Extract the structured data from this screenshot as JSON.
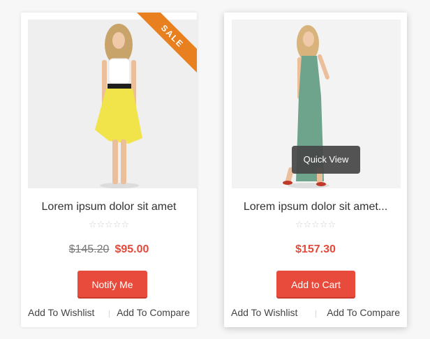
{
  "products": [
    {
      "title": "Lorem ipsum dolor sit amet",
      "rating": 0,
      "old_price": "$145.20",
      "price": "$95.00",
      "badge": "SALE",
      "button_label": "Notify Me",
      "wishlist_label": "Add To Wishlist",
      "compare_label": "Add To Compare"
    },
    {
      "title": "Lorem ipsum dolor sit amet...",
      "rating": 0,
      "price": "$157.30",
      "button_label": "Add to Cart",
      "wishlist_label": "Add To Wishlist",
      "compare_label": "Add To Compare",
      "quick_view_label": "Quick View"
    }
  ],
  "stars": "☆☆☆☆☆",
  "colors": {
    "accent": "#e84b3b",
    "price": "#e4493a",
    "sale_badge": "#e8801f",
    "text": "#333333"
  }
}
